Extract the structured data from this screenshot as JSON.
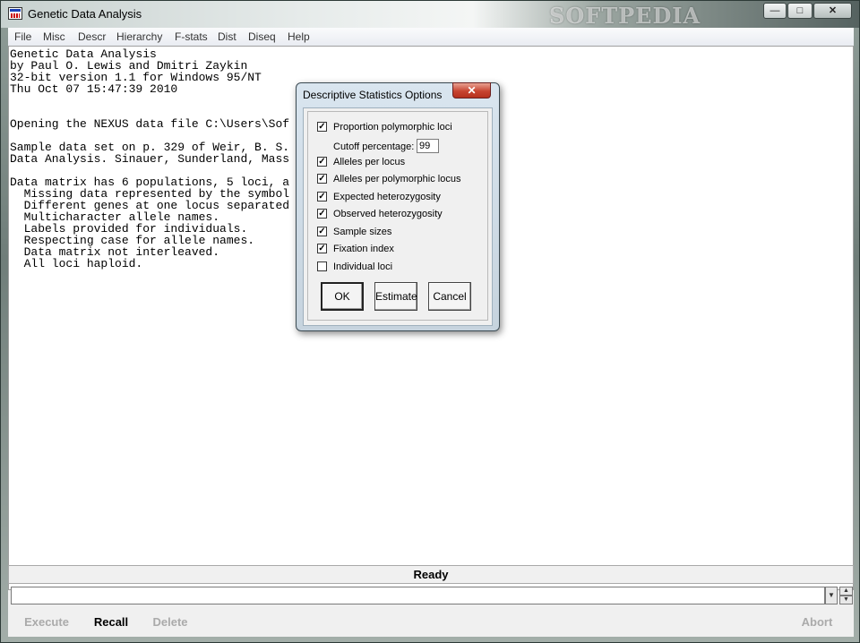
{
  "window": {
    "title": "Genetic Data Analysis",
    "watermark": "SOFTPEDIA",
    "minimize": "—",
    "maximize": "□",
    "close": "✕"
  },
  "menu": [
    "File",
    "Misc",
    "Descr",
    "Hierarchy",
    "F-stats",
    "Dist",
    "Diseq",
    "Help"
  ],
  "output_lines": [
    "Genetic Data Analysis",
    "by Paul O. Lewis and Dmitri Zaykin",
    "32-bit version 1.1 for Windows 95/NT",
    "Thu Oct 07 15:47:39 2010",
    "",
    "Opening the NEXUS data file C:\\Users\\Sof",
    "",
    "Sample data set on p. 329 of Weir, B. S.",
    "Data Analysis. Sinauer, Sunderland, Mass",
    "",
    "Data matrix has 6 populations, 5 loci, a",
    "  Missing data represented by the symbol",
    "  Different genes at one locus separated",
    "  Multicharacter allele names.",
    "  Labels provided for individuals.",
    "  Respecting case for allele names.",
    "  Data matrix not interleaved.",
    "  All loci haploid."
  ],
  "status": "Ready",
  "command": {
    "value": "",
    "buttons": {
      "execute": "Execute",
      "recall": "Recall",
      "delete": "Delete",
      "abort": "Abort"
    }
  },
  "dialog": {
    "title": "Descriptive Statistics Options",
    "close": "✕",
    "options": [
      {
        "label": "Proportion polymorphic loci",
        "checked": true
      },
      {
        "label": "Alleles per locus",
        "checked": true
      },
      {
        "label": "Alleles per polymorphic locus",
        "checked": true
      },
      {
        "label": "Expected heterozygosity",
        "checked": true
      },
      {
        "label": "Observed heterozygosity",
        "checked": true
      },
      {
        "label": "Sample sizes",
        "checked": true
      },
      {
        "label": "Fixation index",
        "checked": true
      },
      {
        "label": "Individual loci",
        "checked": false
      }
    ],
    "cutoff_label": "Cutoff percentage:",
    "cutoff_value": "99",
    "buttons": {
      "ok": "OK",
      "estimate": "Estimate",
      "cancel": "Cancel"
    }
  }
}
